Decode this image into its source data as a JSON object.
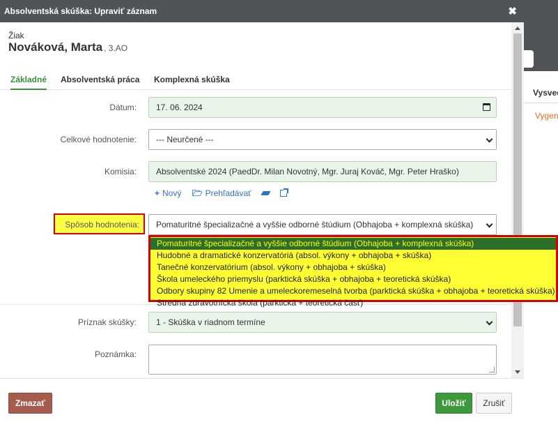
{
  "background_app": {
    "tab_label": "Vysved",
    "link_label": "Vygen"
  },
  "modal": {
    "title": "Absolventská skúška: Upraviť záznam",
    "close_symbol": "✖"
  },
  "student": {
    "label": "Žiak",
    "name": "Nováková, Marta",
    "class": "3.AO"
  },
  "tabs": [
    {
      "label": "Základné",
      "active": true
    },
    {
      "label": "Absolventská práca",
      "active": false
    },
    {
      "label": "Komplexná skúška",
      "active": false
    }
  ],
  "form": {
    "date": {
      "label": "Dátum:",
      "value": "17. 06. 2024"
    },
    "overall": {
      "label": "Celkové hodnotenie:",
      "value": "--- Neurčené ---"
    },
    "commission": {
      "label": "Komisia:",
      "value": "Absolventské 2024 (PaedDr.  Milan Novotný, Mgr.  Juraj Kováč, Mgr.  Peter Hraško)"
    },
    "commission_actions": {
      "new": "Nový",
      "browse": "Prehľadávať"
    },
    "evaluation_method": {
      "label": "Spôsob hodnotenia:",
      "value": "Pomaturitné špecializačné a vyššie odborné štúdium (Obhajoba + komplexná skúška)",
      "options": [
        "Pomaturitné špecializačné a vyššie odborné štúdium (Obhajoba + komplexná skúška)",
        "Hudobné a dramatické konzervatóriá (absol. výkony + obhajoba + skúška)",
        "Tanečné konzervatórium (absol. výkony + obhajoba + skúška)",
        "Škola umeleckého priemyslu (parktická skúška + obhajoba + teoretická skúška)",
        "Odbory skupiny 82 Umenie a umeleckoremeselná tvorba (parktická skúška + obhajoba + teoretická skúška)",
        "Stredná zdravotnícka škola (parktická + teoretická časť)"
      ],
      "selected_index": 0
    },
    "exam_flag": {
      "label": "Príznak skúšky:",
      "value": "1 - Skúška v riadnom termíne"
    },
    "note": {
      "label": "Poznámka:",
      "value": ""
    }
  },
  "footer": {
    "delete_label": "Zmazať",
    "save_label": "Uložiť",
    "cancel_label": "Zrušiť"
  },
  "colors": {
    "header_bg": "#4f5457",
    "accent_green": "#3c8f3c",
    "field_bg": "#e8f5e8",
    "highlight_yellow": "#ffff33",
    "highlight_border": "#d40000",
    "link_blue": "#2f74c0",
    "delete_bg": "#a65d50"
  }
}
